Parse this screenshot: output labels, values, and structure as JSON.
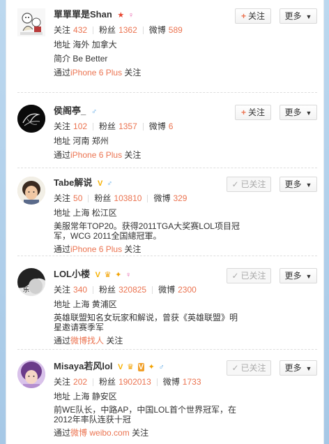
{
  "follow_label": "关注",
  "followed_label": "已关注",
  "more_label": "更多",
  "labels": {
    "follows": "关注",
    "fans": "粉丝",
    "weibo": "微博",
    "address": "地址",
    "intro": "简介",
    "via": "通过"
  },
  "colors": {
    "accent": "#eb7350",
    "male": "#5aa8e6",
    "verified": "#f7b100"
  },
  "users": [
    {
      "name": "單單單是Shan",
      "follows": "432",
      "fans": "1362",
      "weibo": "589",
      "address": "海外 加拿大",
      "intro": "Be Better",
      "via_source": "iPhone 6 Plus",
      "via_suffix": "关注",
      "button": "follow",
      "badges": [
        "star-icon",
        "female-icon"
      ]
    },
    {
      "name": "侯阁亭_",
      "follows": "102",
      "fans": "1357",
      "weibo": "6",
      "address": "河南 郑州",
      "via_source": "iPhone 6 Plus",
      "via_suffix": "关注",
      "button": "follow",
      "badges": [
        "male-icon"
      ]
    },
    {
      "name": "Tabe解说",
      "follows": "50",
      "fans": "103810",
      "weibo": "329",
      "address": "上海 松江区",
      "description": "美服常年TOP20。获得2011TGA大奖赛LOL项目冠军，WCG 2011全国總冠軍。",
      "via_source": "iPhone 6 Plus",
      "via_suffix": "关注",
      "button": "followed",
      "badges": [
        "verified-icon",
        "male-icon"
      ]
    },
    {
      "name": "LOL小楼",
      "follows": "340",
      "fans": "320825",
      "weibo": "2300",
      "address": "上海 黄浦区",
      "description": "英雄联盟知名女玩家和解说，曾获《英雄联盟》明星邀请赛季军",
      "via_source": "微博找人",
      "via_suffix": "关注",
      "button": "followed",
      "badges": [
        "verified-icon",
        "vip-crown-icon",
        "daren-icon",
        "female-icon"
      ]
    },
    {
      "name": "Misaya若风lol",
      "follows": "202",
      "fans": "1902013",
      "weibo": "1733",
      "address": "上海 静安区",
      "description": "前WE队长，中路AP，中国LOL首个世界冠军，在2012年率队连获十冠",
      "via_source": "微博 weibo.com",
      "via_suffix": "关注",
      "button": "followed",
      "badges": [
        "verified-icon",
        "vip-crown-icon",
        "member-icon",
        "daren-icon",
        "male-icon"
      ]
    }
  ]
}
